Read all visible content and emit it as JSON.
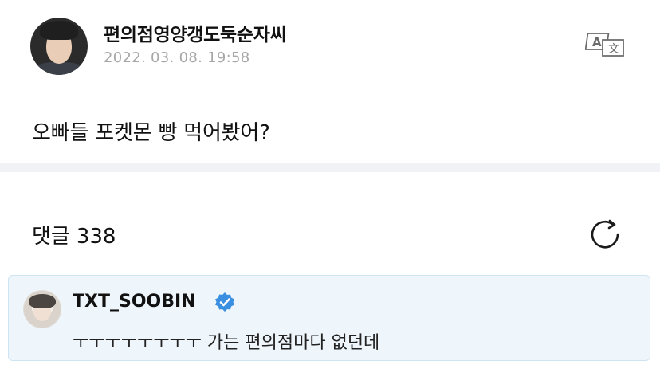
{
  "post": {
    "author": "편의점영양갱도둑순자씨",
    "timestamp": "2022. 03. 08. 19:58",
    "body": "오빠들 포켓몬 빵 먹어봤어?",
    "avatar_icon": "profile-photo",
    "translate_icon": "translate-icon"
  },
  "comments": {
    "label": "댓글",
    "count": "338",
    "refresh_icon": "refresh-icon"
  },
  "highlighted_comment": {
    "author": "TXT_SOOBIN",
    "verified": true,
    "text": "ㅜㅜㅜㅜㅜㅜㅜㅜ 가는 편의점마다 없던데",
    "accent_color": "#3b8fe0",
    "background_color": "#eef6fb"
  }
}
